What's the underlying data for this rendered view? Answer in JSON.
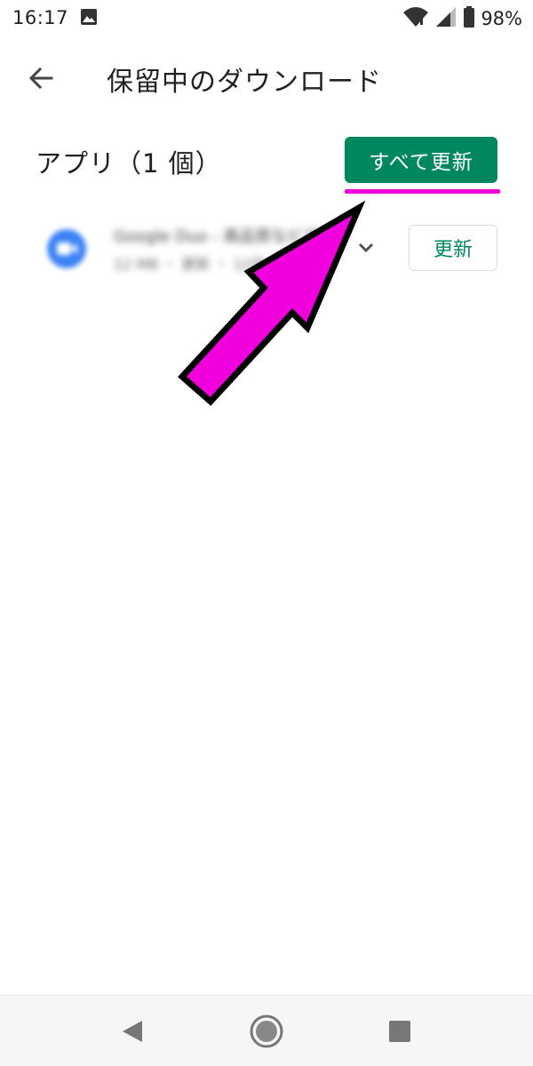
{
  "status_bar": {
    "time": "16:17",
    "battery": "98%",
    "icons": [
      "image-icon",
      "wifi-icon",
      "signal-icon",
      "battery-icon"
    ]
  },
  "app_bar": {
    "back_icon": "arrow-left-icon",
    "title": "保留中のダウンロード"
  },
  "section": {
    "title": "アプリ（1 個）",
    "update_all_label": "すべて更新"
  },
  "apps": [
    {
      "name": "Google Duo - 高品質なビデオ通話",
      "meta": "12 MB ・ 更新 ・ 12月",
      "icon": "google-duo-icon",
      "update_label": "更新"
    }
  ],
  "colors": {
    "accent": "#01875f",
    "annotation": "#f000dc"
  },
  "nav_bar": {
    "icons": [
      "nav-back-icon",
      "nav-home-icon",
      "nav-recents-icon"
    ]
  }
}
